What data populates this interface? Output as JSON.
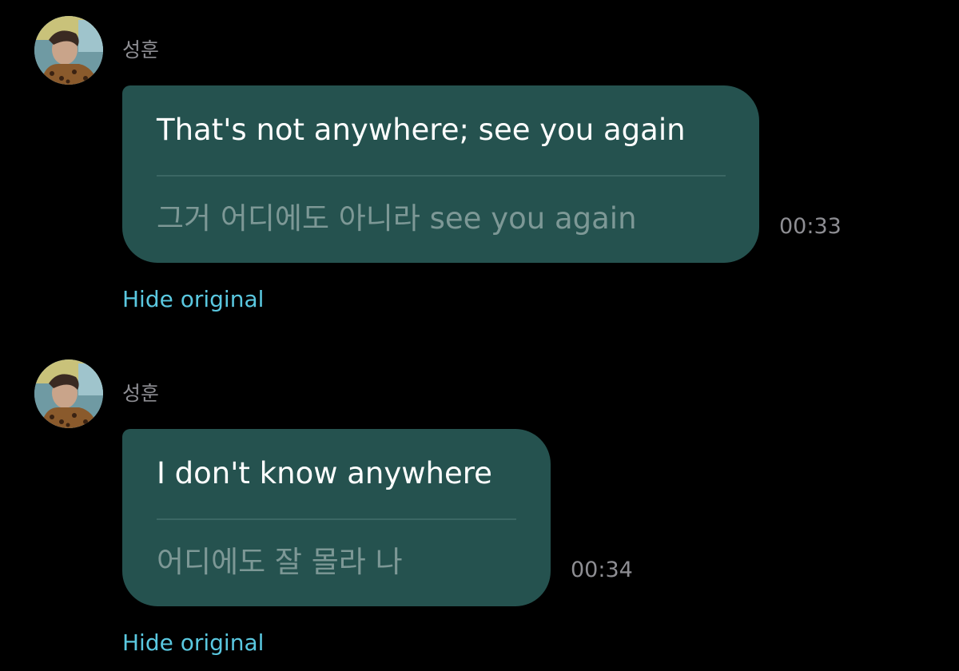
{
  "colors": {
    "background": "#000000",
    "bubble": "#25524f",
    "divider": "#3b6764",
    "translated_text": "#ffffff",
    "original_text": "#7d9896",
    "meta_text": "#8e8e93",
    "link": "#5ac8e0"
  },
  "messages": [
    {
      "sender": "성훈",
      "translated": "That's not anywhere; see you again",
      "original": "그거 어디에도 아니라 see you again",
      "time": "00:33",
      "toggle_label": "Hide original"
    },
    {
      "sender": "성훈",
      "translated": "I don't know anywhere",
      "original": "어디에도 잘 몰라 나",
      "time": "00:34",
      "toggle_label": "Hide original"
    }
  ]
}
